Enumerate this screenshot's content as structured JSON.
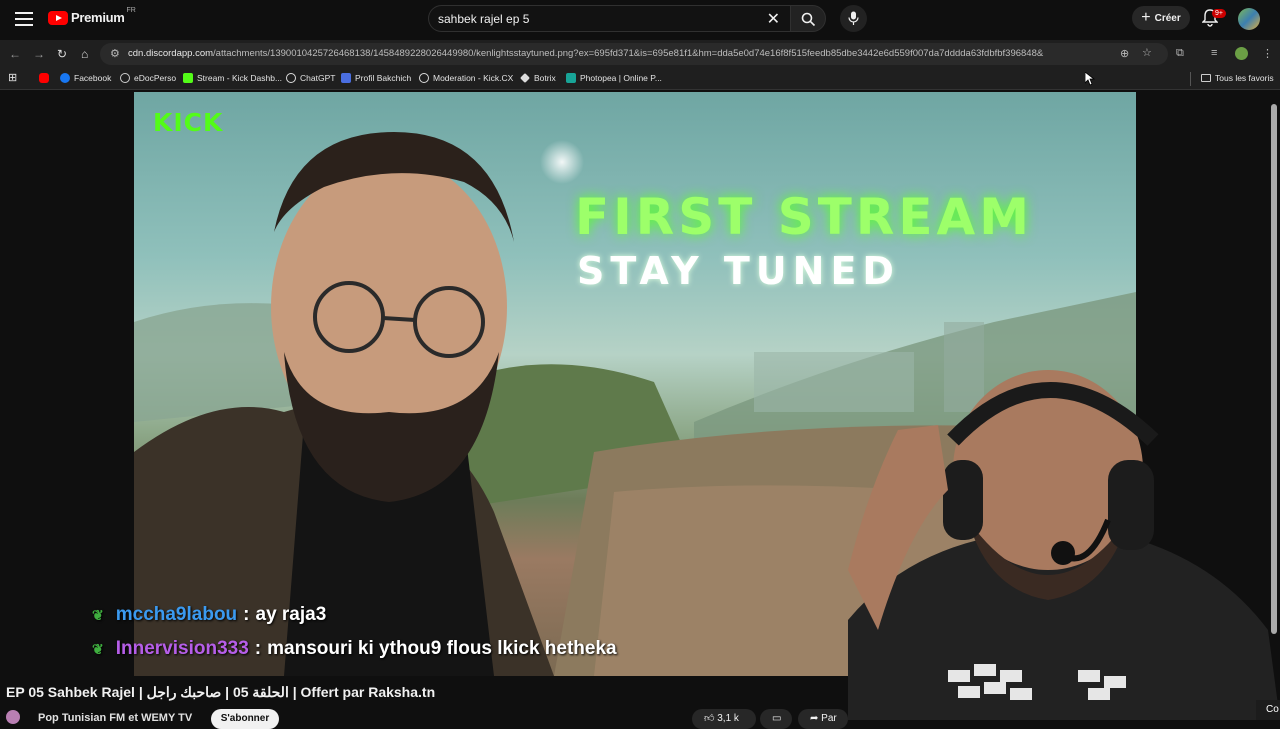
{
  "youtube": {
    "logo_text": "Premium",
    "country": "FR",
    "search_value": "sahbek rajel ep 5",
    "create_label": "Créer",
    "notifications_badge": "9+"
  },
  "browser": {
    "url_host": "cdn.discordapp.com",
    "url_path": "/attachments/1390010425726468138/1458489228026449980/kenlightsstaytuned.png?ex=695fd371&is=695e81f1&hm=dda5e0d74e16f8f515feedb85dbe3442e6d559f007da7dddda63fdbfbf396848&",
    "bookmarks": [
      {
        "label": "",
        "icon": "youtube-icon",
        "color": "#ff0000"
      },
      {
        "label": "Facebook",
        "icon": "facebook-icon",
        "color": "#1877f2"
      },
      {
        "label": "eDocPerso",
        "icon": "edoc-icon",
        "color": "#cccccc"
      },
      {
        "label": "Stream - Kick Dashb...",
        "icon": "kick-icon",
        "color": "#53fc18"
      },
      {
        "label": "ChatGPT",
        "icon": "chatgpt-icon",
        "color": "#dddddd"
      },
      {
        "label": "Profil Bakchich",
        "icon": "bakchich-icon",
        "color": "#4a6ee0"
      },
      {
        "label": "Moderation - Kick.CX",
        "icon": "moderation-icon",
        "color": "#dddddd"
      },
      {
        "label": "Botrix",
        "icon": "botrix-icon",
        "color": "#dddddd"
      },
      {
        "label": "Photopea | Online P...",
        "icon": "photopea-icon",
        "color": "#18a497"
      }
    ],
    "all_bookmarks_label": "Tous les favoris"
  },
  "video": {
    "brand_logo": "KICK",
    "headline": "FIRST STREAM",
    "subheadline": "STAY TUNED"
  },
  "chat": [
    {
      "user": "mccha9labou",
      "separator": ":",
      "message": "ay raja3",
      "user_color": "#3b9af0"
    },
    {
      "user": "Innervision333",
      "separator": ":",
      "message": "mansouri ki ythou9 flous lkick hetheka",
      "user_color": "#b65ee8"
    }
  ],
  "watch": {
    "title": "EP 05 Sahbek Rajel | الحلقة 05 | صاحبك راجل | Offert par Raksha.tn",
    "channel": "Pop Tunisian FM et WEMY TV",
    "subscribe_label": "S'abonner",
    "likes_label": "3,1 k",
    "share_label": "Par",
    "corner_label": "Co"
  },
  "colors": {
    "kick_green": "#53fc18",
    "headline_green": "#9dff6a",
    "youtube_red": "#ff0000"
  }
}
